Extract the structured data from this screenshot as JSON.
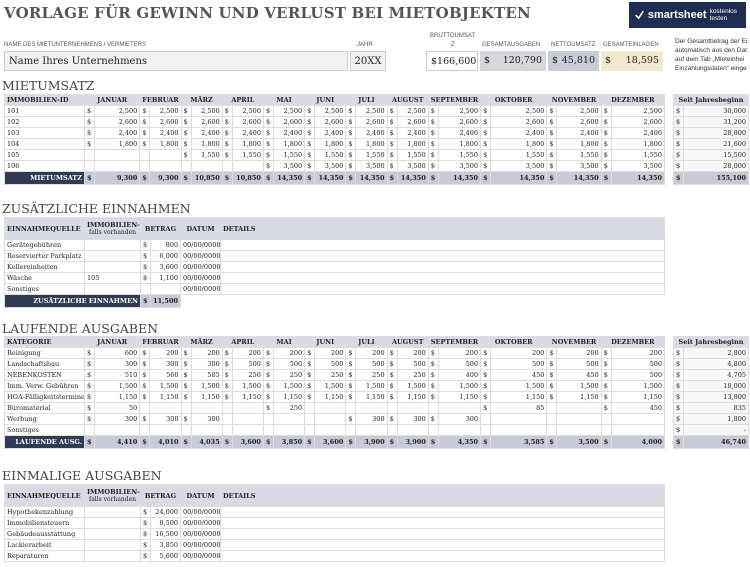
{
  "title": "VORLAGE FÜR GEWINN UND VERLUST BEI MIETOBJEKTEN",
  "logo": {
    "brand": "smartsheet",
    "cta": "kostenlos testen"
  },
  "header": {
    "company_label": "NAME DES MIETUNTERNEHMENS / VERMIETERS",
    "company_value": "Name Ihres Unternehmens",
    "year_label": "JAHR",
    "year_value": "20XX",
    "gross_label_1": "BRUTTOUMSAT",
    "gross_label_2": "Z",
    "gross_value": "166,600",
    "expenses_label": "GESAMTAUSGABEN",
    "expenses_value": "120,790",
    "net_label": "NETTOUMSATZ",
    "net_value": "45,810",
    "deposits_label": "GESAMTEINLAGEN",
    "deposits_value": "18,595",
    "currency": "$",
    "note_lines": [
      "Der Gesamtbetrag der Ei",
      "automatisch aus den Dat",
      "auf dem Tab „Mieteinhei",
      "Einzahlungsdaten“ einge"
    ]
  },
  "rent": {
    "section_title": "MIETUMSATZ",
    "columns": [
      "IMMOBILIEN-ID",
      "JANUAR",
      "FEBRUAR",
      "MÄRZ",
      "APRIL",
      "MAI",
      "JUNI",
      "JULI",
      "AUGUST",
      "SEPTEMBER",
      "OKTOBER",
      "NOVEMBER",
      "DEZEMBER"
    ],
    "ytd_header": "Seit Jahresbeginn",
    "rows": [
      {
        "id": "101",
        "m": [
          "2,500",
          "2,500",
          "2,500",
          "2,500",
          "2,500",
          "2,500",
          "2,500",
          "2,500",
          "2,500",
          "2,500",
          "2,500",
          "2,500"
        ],
        "ytd": "30,000"
      },
      {
        "id": "102",
        "m": [
          "2,600",
          "2,600",
          "2,600",
          "2,600",
          "2,600",
          "2,600",
          "2,600",
          "2,600",
          "2,600",
          "2,600",
          "2,600",
          "2,600"
        ],
        "ytd": "31,200"
      },
      {
        "id": "103",
        "m": [
          "2,400",
          "2,400",
          "2,400",
          "2,400",
          "2,400",
          "2,400",
          "2,400",
          "2,400",
          "2,400",
          "2,400",
          "2,400",
          "2,400"
        ],
        "ytd": "28,800"
      },
      {
        "id": "104",
        "m": [
          "1,800",
          "1,800",
          "1,800",
          "1,800",
          "1,800",
          "1,800",
          "1,800",
          "1,800",
          "1,800",
          "1,800",
          "1,800",
          "1,800"
        ],
        "ytd": "21,600"
      },
      {
        "id": "105",
        "m": [
          "",
          "",
          "1,550",
          "1,550",
          "1,550",
          "1,550",
          "1,550",
          "1,550",
          "1,550",
          "1,550",
          "1,550",
          "1,550"
        ],
        "ytd": "15,500"
      },
      {
        "id": "106",
        "m": [
          "",
          "",
          "",
          "",
          "3,500",
          "3,500",
          "3,500",
          "3,500",
          "3,500",
          "3,500",
          "3,500",
          "3,500"
        ],
        "ytd": "28,000"
      }
    ],
    "total_label": "MIETUMSATZ",
    "totals": [
      "9,300",
      "9,300",
      "10,850",
      "10,850",
      "14,350",
      "14,350",
      "14,350",
      "14,350",
      "14,350",
      "14,350",
      "14,350",
      "14,350"
    ],
    "total_ytd": "155,100"
  },
  "extra": {
    "section_title": "ZUSÄTZLICHE EINNAHMEN",
    "columns": [
      "EINNAHMEQUELLE",
      "IMMOBILIEN-ID",
      "falls vorhanden",
      "BETRAG",
      "DATUM",
      "DETAILS"
    ],
    "rows": [
      {
        "src": "Gerätegebühren",
        "id": "",
        "amt": "800",
        "date": "00/00/0000"
      },
      {
        "src": "Reservierter Parkplatz",
        "id": "",
        "amt": "6,000",
        "date": "00/00/0000"
      },
      {
        "src": "Kellereinheiten",
        "id": "",
        "amt": "3,600",
        "date": "00/00/0000"
      },
      {
        "src": "Wäsche",
        "id": "105",
        "amt": "1,100",
        "date": "00/00/0000"
      },
      {
        "src": "Sonstiges",
        "id": "",
        "amt": "",
        "date": "00/00/0000"
      }
    ],
    "total_label": "ZUSÄTZLICHE EINNAHMEN",
    "total": "11,500"
  },
  "expenses": {
    "section_title": "LAUFENDE AUSGABEN",
    "columns": [
      "KATEGORIE",
      "JANUAR",
      "FEBRUAR",
      "MÄRZ",
      "APRIL",
      "MAI",
      "JUNI",
      "JULI",
      "AUGUST",
      "SEPTEMBER",
      "OKTOBER",
      "NOVEMBER",
      "DEZEMBER"
    ],
    "ytd_header": "Seit Jahresbeginn",
    "rows": [
      {
        "cat": "Reinigung",
        "m": [
          "600",
          "200",
          "200",
          "200",
          "200",
          "200",
          "200",
          "200",
          "200",
          "200",
          "200",
          "200"
        ],
        "ytd": "2,800"
      },
      {
        "cat": "Landschaftsbau",
        "m": [
          "300",
          "300",
          "300",
          "500",
          "500",
          "500",
          "500",
          "500",
          "500",
          "500",
          "500",
          "500"
        ],
        "ytd": "4,800"
      },
      {
        "cat": "NEBENKOSTEN",
        "m": [
          "510",
          "560",
          "585",
          "250",
          "250",
          "250",
          "250",
          "250",
          "400",
          "450",
          "450",
          "500"
        ],
        "ytd": "4,705"
      },
      {
        "cat": "Imm. Verw. Gebühren",
        "m": [
          "1,500",
          "1,500",
          "1,500",
          "1,500",
          "1,500",
          "1,500",
          "1,500",
          "1,500",
          "1,500",
          "1,500",
          "1,500",
          "1,500"
        ],
        "ytd": "18,000"
      },
      {
        "cat": "HOA-Fälligkeitstermine",
        "m": [
          "1,150",
          "1,150",
          "1,150",
          "1,150",
          "1,150",
          "1,150",
          "1,150",
          "1,150",
          "1,150",
          "1,150",
          "1,150",
          "1,150"
        ],
        "ytd": "13,800"
      },
      {
        "cat": "Büromaterial",
        "m": [
          "50",
          "",
          "",
          "",
          "250",
          "",
          "",
          "",
          "",
          "85",
          "",
          "450"
        ],
        "ytd": "835"
      },
      {
        "cat": "Werbung",
        "m": [
          "300",
          "300",
          "300",
          "",
          "",
          "",
          "300",
          "300",
          "300",
          "",
          "",
          "",
          ""
        ],
        "ytd": "1,800"
      },
      {
        "cat": "Sonstiges",
        "m": [
          "",
          "",
          "",
          "",
          "",
          "",
          "",
          "",
          "",
          "",
          "",
          ""
        ],
        "ytd": "-"
      }
    ],
    "total_label": "LAUFENDE AUSG.",
    "totals": [
      "4,410",
      "4,010",
      "4,035",
      "3,600",
      "3,850",
      "3,600",
      "3,900",
      "3,900",
      "4,350",
      "3,585",
      "3,500",
      "4,000"
    ],
    "total_ytd": "46,740"
  },
  "onetime": {
    "section_title": "EINMALIGE AUSGABEN",
    "columns": [
      "EINNAHMEQUELLE",
      "IMMOBILIEN-ID.",
      "falls vorhanden",
      "BETRAG",
      "DATUM",
      "DETAILS"
    ],
    "rows": [
      {
        "src": "Hypothekenzahlung",
        "id": "",
        "amt": "24,000",
        "date": "00/00/0000"
      },
      {
        "src": "Immobiliensteuern",
        "id": "",
        "amt": "8,500",
        "date": "00/00/0000"
      },
      {
        "src": "Gebäudeausstattung",
        "id": "",
        "amt": "16,500",
        "date": "00/00/0000"
      },
      {
        "src": "Lackierarbeit",
        "id": "",
        "amt": "3,850",
        "date": "00/00/0000"
      },
      {
        "src": "Reparaturen",
        "id": "",
        "amt": "5,600",
        "date": "00/00/0000"
      }
    ]
  }
}
